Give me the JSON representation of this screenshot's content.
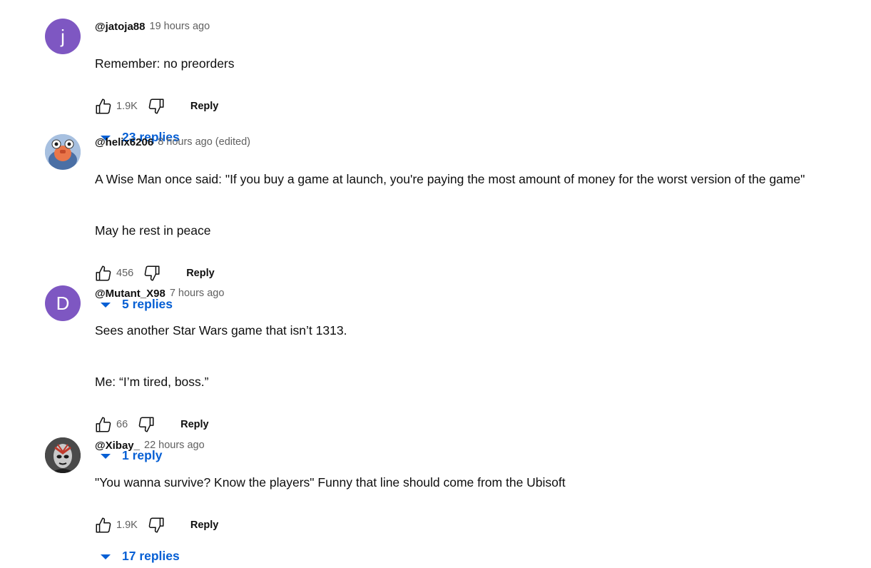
{
  "comments": [
    {
      "author": "@jatoja88",
      "time": "19 hours ago",
      "avatar_letter": "j",
      "avatar_color": "#7e57c2",
      "paragraphs": [
        "Remember: no preorders"
      ],
      "likes": "1.9K",
      "reply_label": "Reply",
      "replies_label": "23 replies"
    },
    {
      "author": "@helix6206",
      "time": "8 hours ago (edited)",
      "avatar_icon": "spongebob-character-avatar",
      "paragraphs": [
        "A Wise Man once said: \"If you buy a game at launch, you're paying the most amount of money for the worst version of the game\"",
        "May he rest in peace"
      ],
      "likes": "456",
      "reply_label": "Reply",
      "replies_label": "5 replies"
    },
    {
      "author": "@Mutant_X98",
      "time": "7 hours ago",
      "avatar_letter": "D",
      "avatar_color": "#7e57c2",
      "paragraphs": [
        "Sees another Star Wars game that isn’t 1313.",
        "Me: “I’m tired, boss.”"
      ],
      "likes": "66",
      "reply_label": "Reply",
      "replies_label": "1 reply"
    },
    {
      "author": "@Xibay_",
      "time": "22 hours ago",
      "avatar_icon": "masked-figure-avatar",
      "paragraphs": [
        "\"You wanna survive? Know the players\" Funny that line should come from the Ubisoft"
      ],
      "likes": "1.9K",
      "reply_label": "Reply",
      "replies_label": "17 replies"
    }
  ],
  "colors": {
    "link": "#065fd4",
    "secondary_text": "#606060"
  }
}
